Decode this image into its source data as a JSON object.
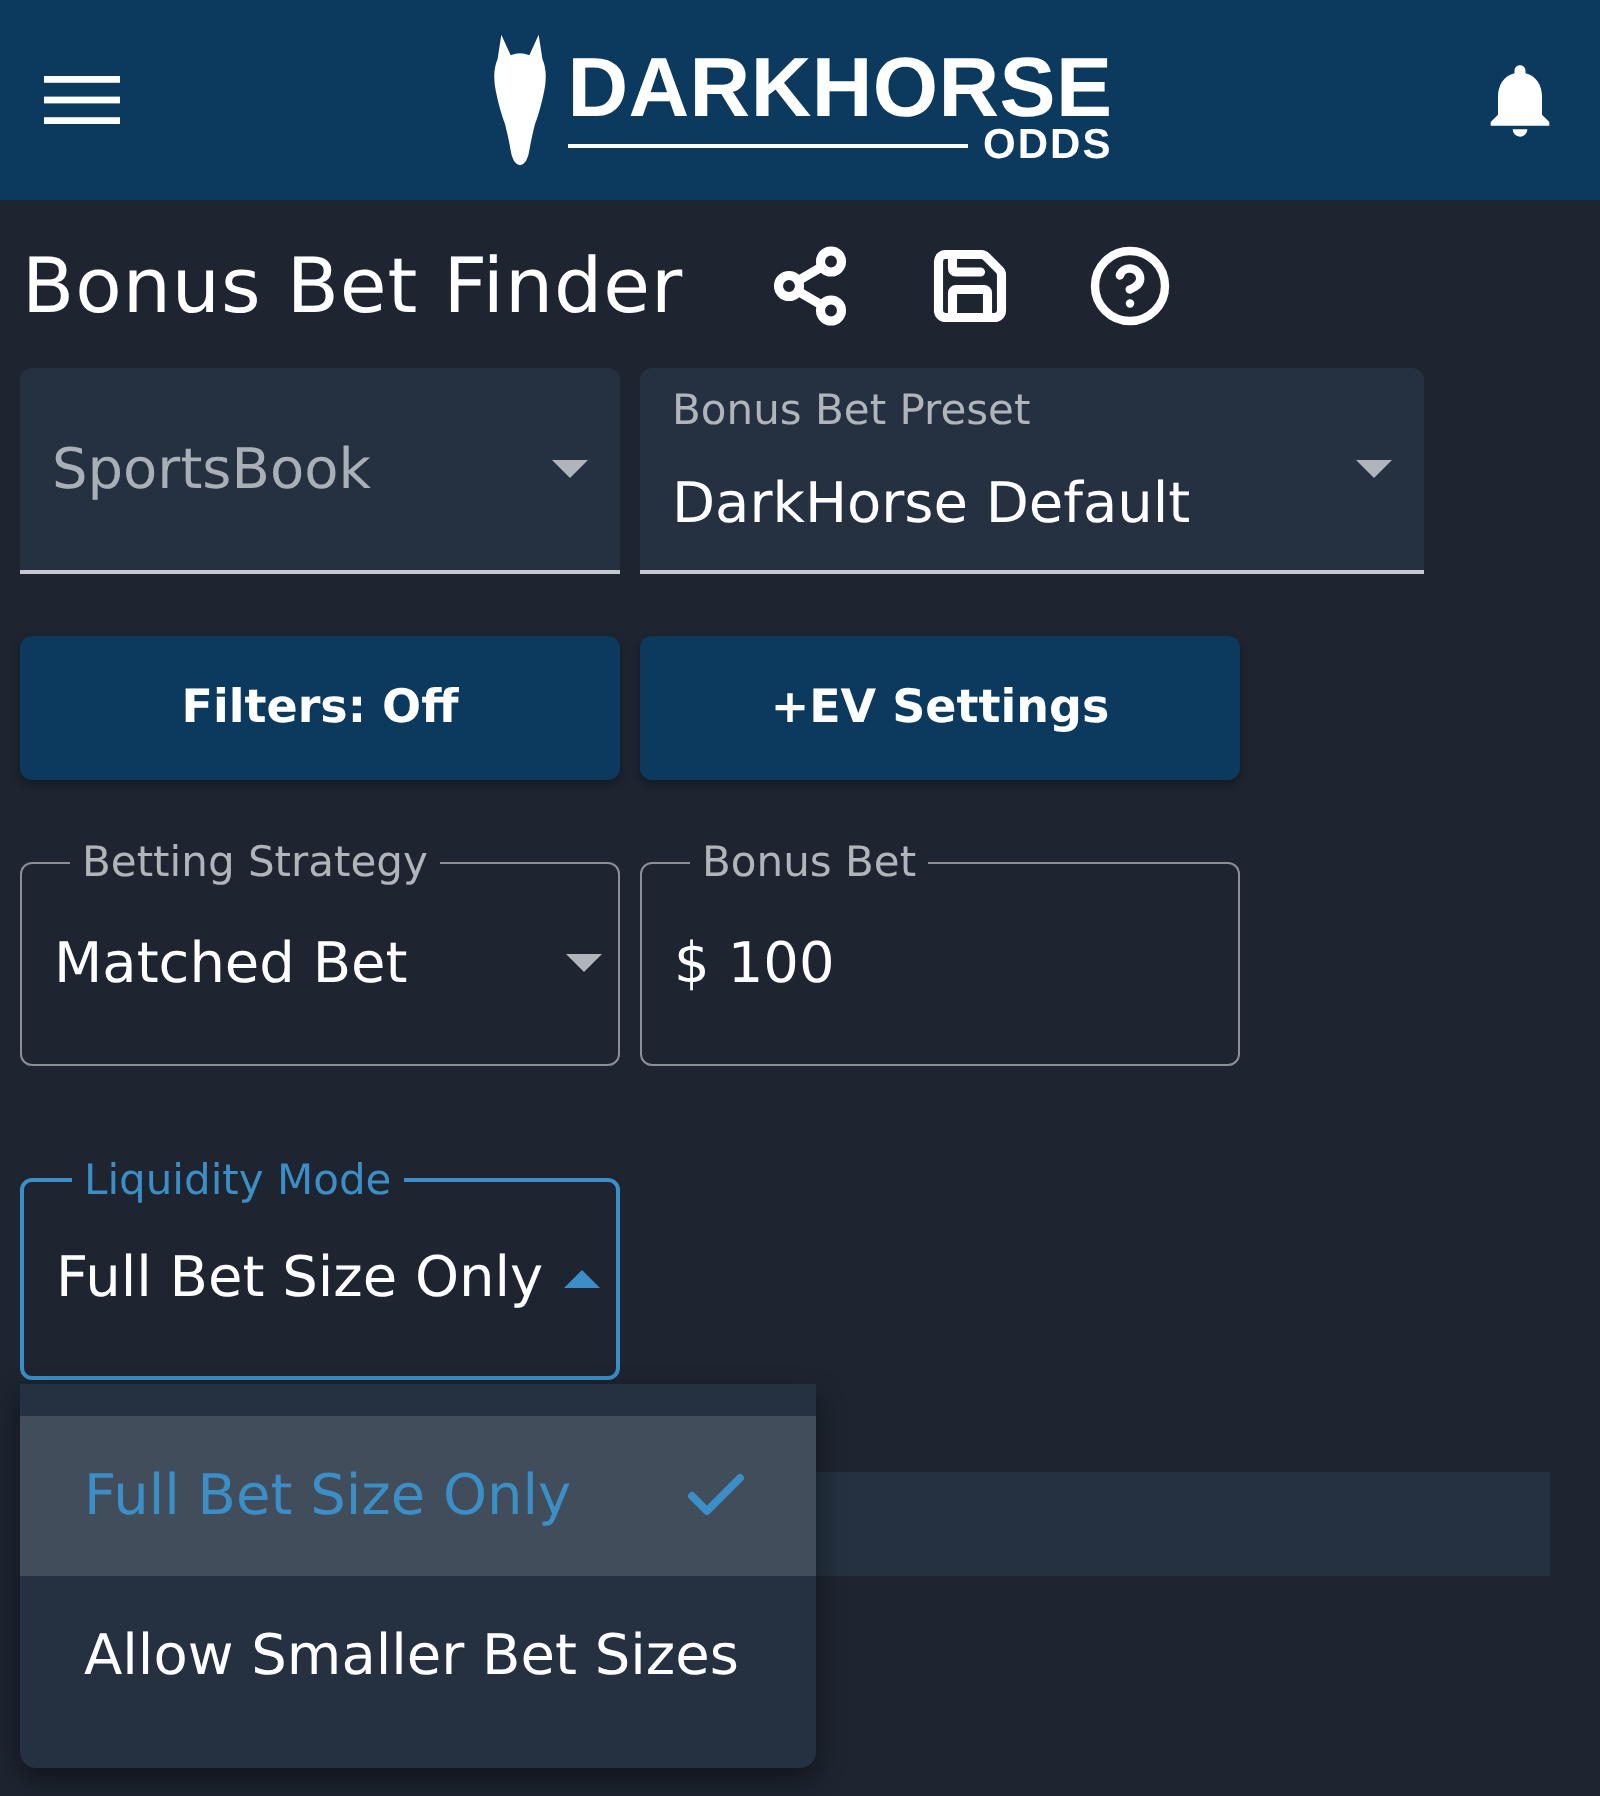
{
  "header": {
    "logo": {
      "wordmark": "DARKHORSE",
      "tagline": "ODDS"
    }
  },
  "page": {
    "title": "Bonus Bet Finder"
  },
  "filled_selects": [
    {
      "placeholder": "SportsBook"
    },
    {
      "label": "Bonus Bet Preset",
      "value": "DarkHorse Default"
    }
  ],
  "buttons": [
    {
      "label": "Filters: Off"
    },
    {
      "label": "+EV Settings"
    }
  ],
  "settings_fields": [
    {
      "kind": "select",
      "label": "Betting Strategy",
      "value": "Matched Bet",
      "focused": false,
      "expanded": false
    },
    {
      "kind": "text",
      "label": "Bonus Bet",
      "prefix": "$",
      "value": "100",
      "focused": false
    },
    {
      "kind": "select",
      "label": "Liquidity Mode",
      "value": "Full Bet Size Only",
      "focused": true,
      "expanded": true,
      "options": [
        {
          "label": "Full Bet Size Only",
          "selected": true
        },
        {
          "label": "Allow Smaller Bet Sizes",
          "selected": false
        }
      ]
    }
  ]
}
